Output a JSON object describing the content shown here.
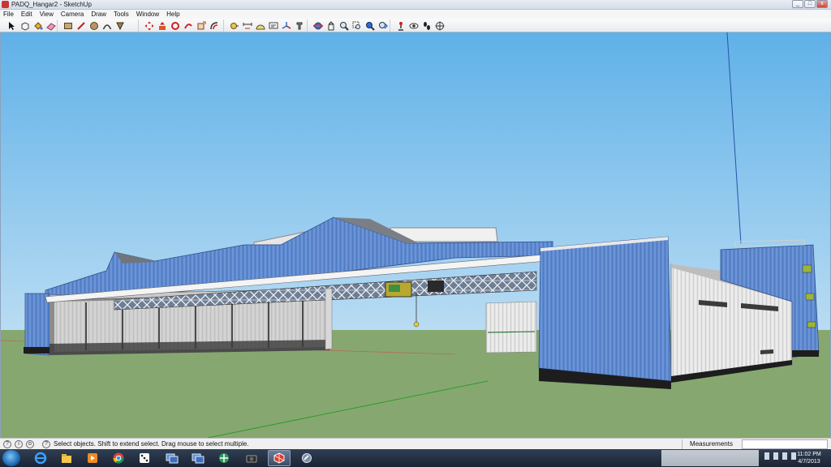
{
  "window": {
    "title": "PADQ_Hangar2 - SketchUp",
    "controls": [
      "_",
      "□",
      "x"
    ]
  },
  "menu": {
    "items": [
      "File",
      "Edit",
      "View",
      "Camera",
      "Draw",
      "Tools",
      "Window",
      "Help"
    ]
  },
  "toolbar": {
    "groups": [
      [
        "select-tool-icon",
        "make-component-icon",
        "paint-bucket-icon",
        "eraser-icon"
      ],
      [
        "rectangle-tool-icon",
        "line-tool-icon",
        "circle-tool-icon",
        "arc-tool-icon",
        "polygon-tool-icon",
        "freehand-tool-icon"
      ],
      [
        "move-tool-icon",
        "push-pull-tool-icon",
        "rotate-tool-icon",
        "follow-me-tool-icon",
        "scale-tool-icon",
        "offset-tool-icon"
      ],
      [
        "tape-measure-icon",
        "dimension-icon",
        "protractor-icon",
        "text-tool-icon",
        "axes-tool-icon",
        "3d-text-icon"
      ],
      [
        "orbit-icon",
        "pan-icon",
        "zoom-icon",
        "zoom-window-icon",
        "zoom-extents-icon",
        "previous-view-icon"
      ],
      [
        "position-camera-icon",
        "look-around-icon",
        "walk-icon",
        "section-plane-icon"
      ]
    ]
  },
  "status": {
    "message": "Select objects. Shift to extend select. Drag mouse to select multiple.",
    "measurements_label": "Measurements",
    "measurements_value": ""
  },
  "taskbar": {
    "apps": [
      "internet-explorer-icon",
      "file-explorer-icon",
      "media-player-icon",
      "chrome-icon",
      "game-icon",
      "remote-desktop-icon",
      "remote-desktop-2-icon",
      "network-icon",
      "camera-icon",
      "sketchup-icon",
      "settings-icon"
    ],
    "active_app": "sketchup-icon",
    "clock_time": "11:02 PM",
    "clock_date": "4/7/2013"
  },
  "colors": {
    "sky_top": "#5fb1e8",
    "sky_bottom": "#b9dcf3",
    "ground": "#86a870",
    "wall_blue": "#5b87cf",
    "wall_white": "#e3e3e3"
  }
}
